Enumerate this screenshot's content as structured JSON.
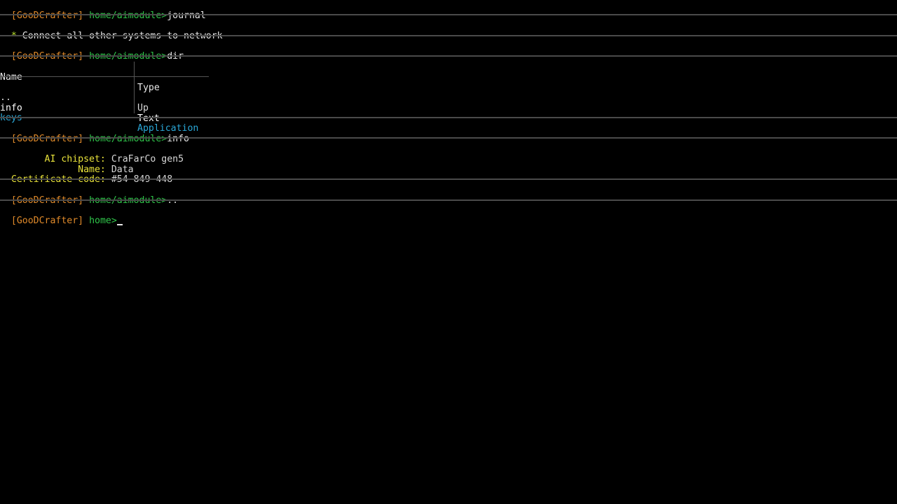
{
  "prompt": {
    "user": "[GooDCrafter]"
  },
  "history": [
    {
      "path": "home/aimodule>",
      "command": "journal"
    },
    {
      "path": "home/aimodule>",
      "command": "dir"
    },
    {
      "path": "home/aimodule>",
      "command": "info"
    },
    {
      "path": "home/aimodule>",
      "command": ".."
    }
  ],
  "journal": {
    "bullet": "*",
    "entry": "Connect all other systems to network"
  },
  "dir": {
    "headers": {
      "name": "Name",
      "type": "Type"
    },
    "rows": [
      {
        "name": "..",
        "type": "Up"
      },
      {
        "name": "info",
        "type": "Text"
      },
      {
        "name": "keys",
        "type": "Application"
      }
    ]
  },
  "info": {
    "fields": [
      {
        "label": "      AI chipset:",
        "value": "CraFarCo gen5"
      },
      {
        "label": "            Name:",
        "value": "Data"
      },
      {
        "label": "Certificate code:",
        "value": "#54 849 448"
      }
    ]
  },
  "current": {
    "path": "home>",
    "command": ""
  },
  "colors": {
    "user": "#e08a2a",
    "path": "#2fc64a",
    "label": "#e8e23a",
    "app": "#2aa8d8",
    "separator": "#4a4a4a"
  }
}
